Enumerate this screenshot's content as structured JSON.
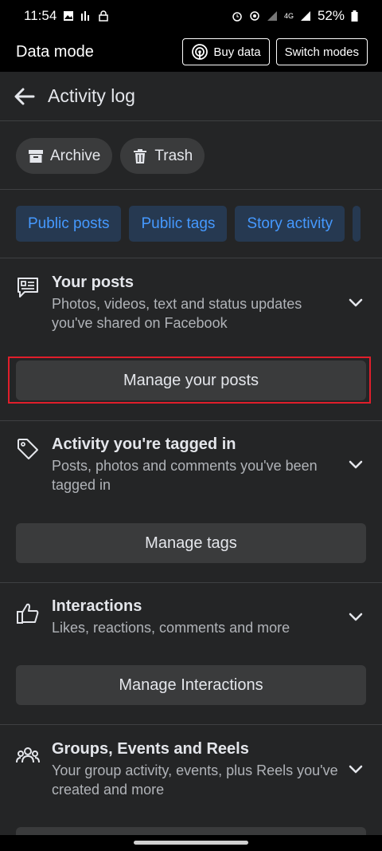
{
  "status_bar": {
    "time": "11:54",
    "network": "4G",
    "battery": "52%"
  },
  "data_mode": {
    "title": "Data mode",
    "buy_data_label": "Buy data",
    "switch_modes_label": "Switch modes"
  },
  "header": {
    "title": "Activity log"
  },
  "actions": [
    {
      "label": "Archive",
      "icon": "archive-icon"
    },
    {
      "label": "Trash",
      "icon": "trash-icon"
    }
  ],
  "filters": [
    "Public posts",
    "Public tags",
    "Story activity"
  ],
  "sections": [
    {
      "title": "Your posts",
      "description": "Photos, videos, text and status updates you've shared on Facebook",
      "icon": "posts-icon",
      "button": "Manage your posts"
    },
    {
      "title": "Activity you're tagged in",
      "description": "Posts, photos and comments you've been tagged in",
      "icon": "tag-icon",
      "button": "Manage tags"
    },
    {
      "title": "Interactions",
      "description": "Likes, reactions, comments and more",
      "icon": "thumbs-up-icon",
      "button": "Manage Interactions"
    },
    {
      "title": "Groups, Events and Reels",
      "description": "Your group activity, events, plus Reels you've created and more",
      "icon": "groups-icon"
    }
  ],
  "colors": {
    "background": "#242526",
    "filter_bg": "#263951",
    "filter_text": "#4599ff",
    "highlight": "#e01e2b"
  }
}
